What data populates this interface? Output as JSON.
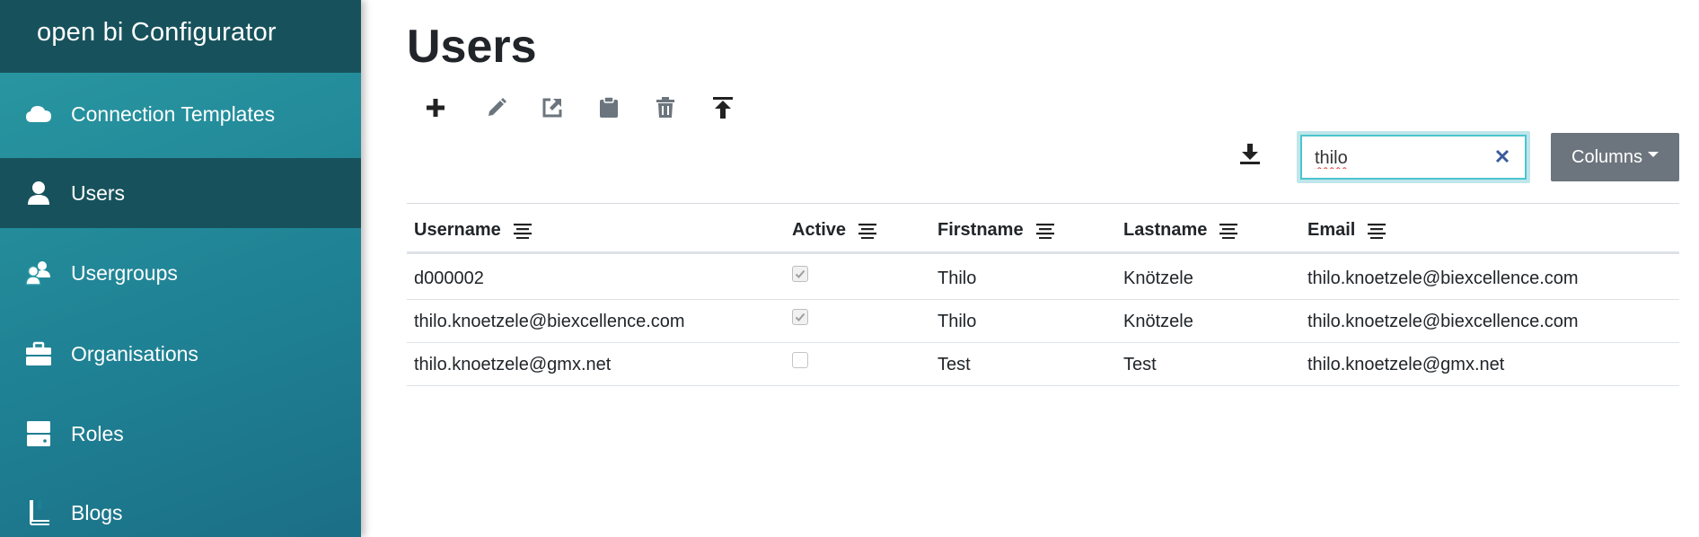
{
  "app": {
    "title": "open bi Configurator"
  },
  "sidebar": {
    "items": [
      {
        "label": "Connection Templates",
        "icon": "cloud-icon",
        "active": false
      },
      {
        "label": "Users",
        "icon": "user-icon",
        "active": true
      },
      {
        "label": "Usergroups",
        "icon": "users-icon",
        "active": false
      },
      {
        "label": "Organisations",
        "icon": "briefcase-icon",
        "active": false
      },
      {
        "label": "Roles",
        "icon": "server-icon",
        "active": false
      },
      {
        "label": "Blogs",
        "icon": "book-icon",
        "active": false
      }
    ]
  },
  "page": {
    "title": "Users"
  },
  "toolbar": {
    "buttons": [
      "plus-icon",
      "pencil-icon",
      "external-link-icon",
      "clipboard-icon",
      "trash-icon",
      "upload-icon"
    ]
  },
  "search": {
    "value": "thilo"
  },
  "columns_button": {
    "label": "Columns"
  },
  "table": {
    "headers": [
      "Username",
      "Active",
      "Firstname",
      "Lastname",
      "Email"
    ],
    "rows": [
      {
        "username": "d000002",
        "active": true,
        "firstname": "Thilo",
        "lastname": "Knötzele",
        "email": "thilo.knoetzele@biexcellence.com"
      },
      {
        "username": "thilo.knoetzele@biexcellence.com",
        "active": true,
        "firstname": "Thilo",
        "lastname": "Knötzele",
        "email": "thilo.knoetzele@biexcellence.com"
      },
      {
        "username": "thilo.knoetzele@gmx.net",
        "active": false,
        "firstname": "Test",
        "lastname": "Test",
        "email": "thilo.knoetzele@gmx.net"
      }
    ]
  },
  "colors": {
    "sidebar_dark": "#17525c",
    "sidebar_gradient_start": "#2a9aa3",
    "sidebar_gradient_end": "#1b6f86",
    "columns_button": "#6c757d",
    "search_focus": "#4cc4cf"
  }
}
